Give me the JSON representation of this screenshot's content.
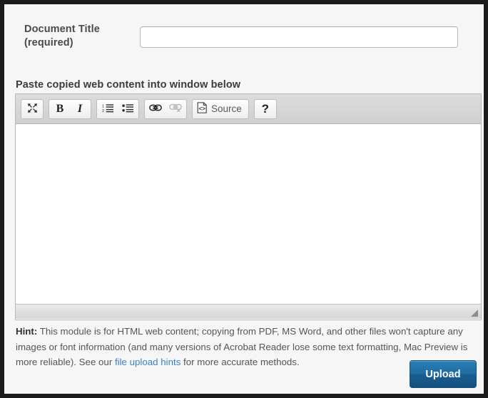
{
  "form": {
    "title_field": {
      "label_line1": "Document Title",
      "label_line2": "(required)",
      "value": "",
      "placeholder": ""
    },
    "paste_label": "Paste copied web content into window below"
  },
  "editor": {
    "toolbar": {
      "groups": [
        {
          "name": "view",
          "buttons": [
            {
              "name": "maximize",
              "icon": "maximize-icon",
              "label": "",
              "disabled": false
            }
          ]
        },
        {
          "name": "basic-styles",
          "buttons": [
            {
              "name": "bold",
              "icon": "bold-icon",
              "label": "B",
              "disabled": false
            },
            {
              "name": "italic",
              "icon": "italic-icon",
              "label": "I",
              "disabled": false
            }
          ]
        },
        {
          "name": "lists",
          "buttons": [
            {
              "name": "numbered-list",
              "icon": "numbered-list-icon",
              "label": "",
              "disabled": false
            },
            {
              "name": "bulleted-list",
              "icon": "bulleted-list-icon",
              "label": "",
              "disabled": false
            }
          ]
        },
        {
          "name": "links",
          "buttons": [
            {
              "name": "link",
              "icon": "link-icon",
              "label": "",
              "disabled": false
            },
            {
              "name": "unlink",
              "icon": "unlink-icon",
              "label": "",
              "disabled": true
            }
          ]
        },
        {
          "name": "source",
          "buttons": [
            {
              "name": "source",
              "icon": "source-code-icon",
              "label": "Source",
              "disabled": false
            }
          ]
        },
        {
          "name": "help",
          "buttons": [
            {
              "name": "help",
              "icon": "question-mark-icon",
              "label": "?",
              "disabled": false
            }
          ]
        }
      ]
    },
    "content": "",
    "status_text": ""
  },
  "hint": {
    "prefix": "Hint:",
    "text_before_link": " This module is for HTML web content; copying from PDF, MS Word, and other files won't capture any images or font information (and many versions of Acrobat Reader lose some text formatting, Mac Preview is more reliable). See our ",
    "link_text": "file upload hints",
    "text_after_link": " for more accurate methods."
  },
  "actions": {
    "upload_label": "Upload"
  },
  "colors": {
    "link": "#3b82c4",
    "upload_button": "#1d6ba1",
    "page_background": "#f6f6f6",
    "toolbar_background": "#d4d4d4",
    "frame_border": "#1c1c1c"
  }
}
